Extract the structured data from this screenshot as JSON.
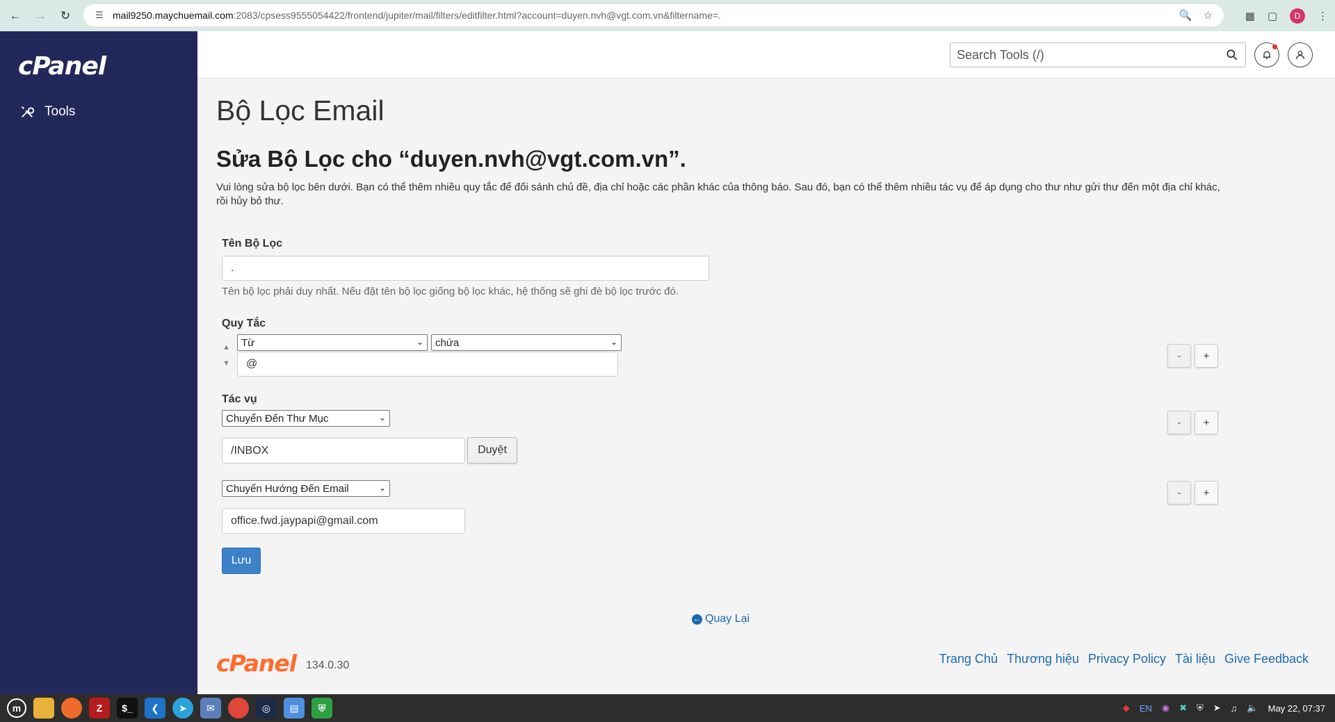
{
  "browser": {
    "url_host": "mail9250.maychuemail.com",
    "url_path": ":2083/cpsess9555054422/frontend/jupiter/mail/filters/editfilter.html?account=duyen.nvh@vgt.com.vn&filtername=.",
    "profile_initial": "D"
  },
  "sidebar": {
    "brand": "cPanel",
    "items": [
      {
        "label": "Tools"
      }
    ]
  },
  "header": {
    "search_placeholder": "Search Tools (/)"
  },
  "main": {
    "page_title": "Bộ Lọc Email",
    "sub_title": "Sửa Bộ Lọc cho “duyen.nvh@vgt.com.vn”.",
    "description": "Vui lòng sửa bộ lọc bên dưới. Bạn có thể thêm nhiều quy tắc để đối sánh chủ đề, địa chỉ hoặc các phần khác của thông báo. Sau đó, bạn có thể thêm nhiều tác vụ để áp dụng cho thư như gửi thư đến một địa chỉ khác, rồi hủy bỏ thư.",
    "filter_name": {
      "label": "Tên Bộ Lọc",
      "value": ".",
      "help": "Tên bộ lọc phải duy nhất. Nếu đặt tên bộ lọc giống bộ lọc khác, hệ thống sẽ ghi đè bộ lọc trước đó."
    },
    "rules": {
      "label": "Quy Tắc",
      "part_select": "Từ",
      "match_select": "chứa",
      "value": "@"
    },
    "actions": {
      "label": "Tác vụ",
      "items": [
        {
          "select": "Chuyển Đến Thư Mục",
          "value": "/INBOX",
          "browse_label": "Duyệt"
        },
        {
          "select": "Chuyển Hướng Đến Email",
          "value": "office.fwd.jaypapi@gmail.com"
        }
      ]
    },
    "minus_label": "-",
    "plus_label": "+",
    "save_label": "Lưu",
    "back_label": "Quay Lại"
  },
  "footer": {
    "logo": "cPanel",
    "version": "134.0.30",
    "links": [
      "Trang Chủ",
      "Thương hiệu",
      "Privacy Policy",
      "Tài liệu",
      "Give Feedback"
    ]
  },
  "taskbar": {
    "lang": "EN",
    "clock": "May 22, 07:37"
  }
}
